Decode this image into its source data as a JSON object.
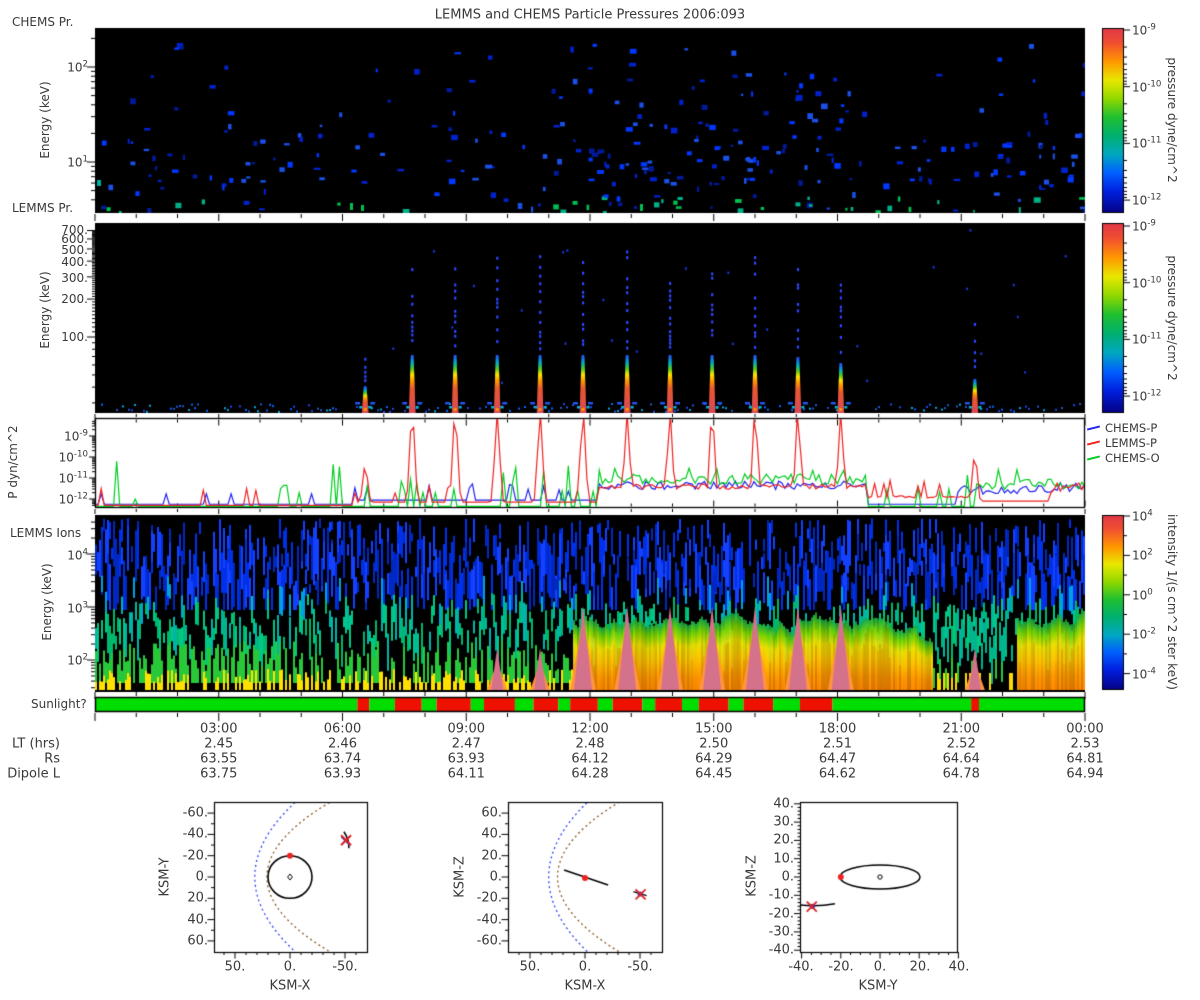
{
  "title": "LEMMS and CHEMS Particle Pressures  2006:093",
  "panels": {
    "chems": {
      "label": "CHEMS Pr.",
      "ylabel": "Energy (keV)",
      "ytick_labels": [
        "10^2",
        "10^1"
      ]
    },
    "lemms": {
      "label": "LEMMS Pr.",
      "ylabel": "Energy (keV)",
      "ytick_labels": [
        "700.",
        "600.",
        "500.",
        "400.",
        "300.",
        "200.",
        "100."
      ]
    },
    "pressure": {
      "ylabel": "P dyn/cm^2",
      "ytick_labels": [
        "10^-9",
        "10^-10",
        "10^-11",
        "10^-12"
      ]
    },
    "ions": {
      "label": "LEMMS Ions",
      "ylabel": "Energy (keV)",
      "ytick_labels": [
        "10^4",
        "10^3",
        "10^2"
      ]
    }
  },
  "colorbars": {
    "pressure_top": {
      "label": "pressure dyne/cm^2",
      "tick_labels": [
        "10^-9",
        "10^-10",
        "10^-11",
        "10^-12"
      ]
    },
    "pressure_mid": {
      "label": "pressure dyne/cm^2",
      "tick_labels": [
        "10^-9",
        "10^-10",
        "10^-11",
        "10^-12"
      ]
    },
    "intensity": {
      "label": "intensity 1/(s cm^2 ster keV)",
      "tick_labels": [
        "10^4",
        "10^2",
        "10^0",
        "10^-2",
        "10^-4"
      ]
    }
  },
  "legend": [
    {
      "label": "CHEMS-P",
      "color": "#2222ee"
    },
    {
      "label": "LEMMS-P",
      "color": "#ee2222"
    },
    {
      "label": "CHEMS-O",
      "color": "#00cc22"
    }
  ],
  "sunlight": {
    "label": "Sunlight?",
    "colors": {
      "sunlit": "#00dd00",
      "shadow": "#ee1100"
    },
    "segments": [
      {
        "state": "sunlit",
        "from": 0,
        "to": 6.36
      },
      {
        "state": "shadow",
        "from": 6.36,
        "to": 6.65
      },
      {
        "state": "sunlit",
        "from": 6.65,
        "to": 7.27
      },
      {
        "state": "shadow",
        "from": 7.27,
        "to": 7.92
      },
      {
        "state": "sunlit",
        "from": 7.92,
        "to": 8.28
      },
      {
        "state": "shadow",
        "from": 8.28,
        "to": 9.11
      },
      {
        "state": "sunlit",
        "from": 9.11,
        "to": 9.43
      },
      {
        "state": "shadow",
        "from": 9.43,
        "to": 10.18
      },
      {
        "state": "sunlit",
        "from": 10.18,
        "to": 10.63
      },
      {
        "state": "shadow",
        "from": 10.63,
        "to": 11.23
      },
      {
        "state": "sunlit",
        "from": 11.23,
        "to": 11.52
      },
      {
        "state": "shadow",
        "from": 11.52,
        "to": 12.19
      },
      {
        "state": "sunlit",
        "from": 12.19,
        "to": 12.55
      },
      {
        "state": "shadow",
        "from": 12.55,
        "to": 13.27
      },
      {
        "state": "sunlit",
        "from": 13.27,
        "to": 13.58
      },
      {
        "state": "shadow",
        "from": 13.58,
        "to": 14.23
      },
      {
        "state": "sunlit",
        "from": 14.23,
        "to": 14.64
      },
      {
        "state": "shadow",
        "from": 14.64,
        "to": 15.36
      },
      {
        "state": "sunlit",
        "from": 15.36,
        "to": 15.72
      },
      {
        "state": "shadow",
        "from": 15.72,
        "to": 16.44
      },
      {
        "state": "sunlit",
        "from": 16.44,
        "to": 17.09
      },
      {
        "state": "shadow",
        "from": 17.09,
        "to": 17.88
      },
      {
        "state": "sunlit",
        "from": 17.88,
        "to": 21.24
      },
      {
        "state": "shadow",
        "from": 21.24,
        "to": 21.43
      },
      {
        "state": "sunlit",
        "from": 21.43,
        "to": 24
      }
    ]
  },
  "time_axis": {
    "tick_labels": [
      "03:00",
      "06:00",
      "09:00",
      "12:00",
      "15:00",
      "18:00",
      "21:00",
      "00:00"
    ],
    "rows": [
      {
        "label": "LT (hrs)",
        "values": [
          "2.45",
          "2.46",
          "2.47",
          "2.48",
          "2.50",
          "2.51",
          "2.52",
          "2.53"
        ]
      },
      {
        "label": "Rs",
        "values": [
          "63.55",
          "63.74",
          "63.93",
          "64.12",
          "64.29",
          "64.47",
          "64.64",
          "64.81"
        ]
      },
      {
        "label": "Dipole L",
        "values": [
          "63.75",
          "63.93",
          "64.11",
          "64.28",
          "64.45",
          "64.62",
          "64.78",
          "64.94"
        ]
      }
    ]
  },
  "orbits": [
    {
      "xlabel": "KSM-X",
      "ylabel": "KSM-Y",
      "xtick_labels": [
        "50.",
        "0.",
        "-50."
      ],
      "ytick_labels": [
        "-60.",
        "-40.",
        "-20.",
        "0.",
        "20.",
        "40.",
        "60."
      ]
    },
    {
      "xlabel": "KSM-X",
      "ylabel": "KSM-Z",
      "xtick_labels": [
        "50.",
        "0.",
        "-50."
      ],
      "ytick_labels": [
        "60.",
        "40.",
        "20.",
        "0.",
        "-20.",
        "-40.",
        "-60."
      ]
    },
    {
      "xlabel": "KSM-Y",
      "ylabel": "KSM-Z",
      "xtick_labels": [
        "-40.",
        "-20.",
        "0.",
        "20.",
        "40."
      ],
      "ytick_labels": [
        "40.",
        "30.",
        "20.",
        "10.",
        "0.",
        "-10.",
        "-20.",
        "-30.",
        "-40."
      ]
    }
  ],
  "chart_data": {
    "date": "2006:093",
    "time_range_hours": [
      0,
      24
    ],
    "injections": [
      {
        "hour": 6.55,
        "amp": 0.45
      },
      {
        "hour": 7.69,
        "amp": 1
      },
      {
        "hour": 8.73,
        "amp": 1
      },
      {
        "hour": 9.75,
        "amp": 1
      },
      {
        "hour": 10.79,
        "amp": 1
      },
      {
        "hour": 11.83,
        "amp": 1
      },
      {
        "hour": 12.9,
        "amp": 1
      },
      {
        "hour": 13.94,
        "amp": 1
      },
      {
        "hour": 14.96,
        "amp": 1
      },
      {
        "hour": 16.0,
        "amp": 1
      },
      {
        "hour": 17.04,
        "amp": 0.95
      },
      {
        "hour": 18.08,
        "amp": 0.85
      },
      {
        "hour": 21.33,
        "amp": 0.58
      }
    ],
    "ion_band": {
      "active_hours": [
        [
          11.55,
          20.3
        ],
        [
          22.35,
          24
        ]
      ],
      "patchy_hours": [
        20.3,
        22.35
      ]
    },
    "heatmaps": [
      {
        "name": "CHEMS pressure",
        "y_range_kev": [
          3,
          260
        ],
        "value_range": [
          "1e-12",
          "1e-9"
        ]
      },
      {
        "name": "LEMMS pressure",
        "y_range_kev": [
          25,
          800
        ],
        "value_range": [
          "1e-12",
          "1e-9"
        ]
      },
      {
        "name": "LEMMS ion intensity",
        "y_range_kev": [
          30,
          60000
        ],
        "value_range": [
          "1e-5",
          "1e4"
        ]
      }
    ],
    "pressure_plot": {
      "type": "line",
      "y_range": [
        "1e-12",
        "1e-9"
      ],
      "series": [
        "CHEMS-P",
        "LEMMS-P",
        "CHEMS-O"
      ]
    },
    "orbit_geometry": {
      "bow_shock_standoff_rs": 32,
      "magnetopause_standoff_rs": 21,
      "titan_orbit_radius_rs": 20,
      "titan_xy": [
        0,
        -20
      ],
      "titan_xz": [
        0,
        -1
      ],
      "titan_yz": [
        -20,
        0
      ],
      "spacecraft_xy": [
        -51,
        -34.5
      ],
      "spacecraft_xz": [
        -50,
        -16
      ],
      "spacecraft_yz": [
        -34.5,
        -16
      ]
    }
  }
}
